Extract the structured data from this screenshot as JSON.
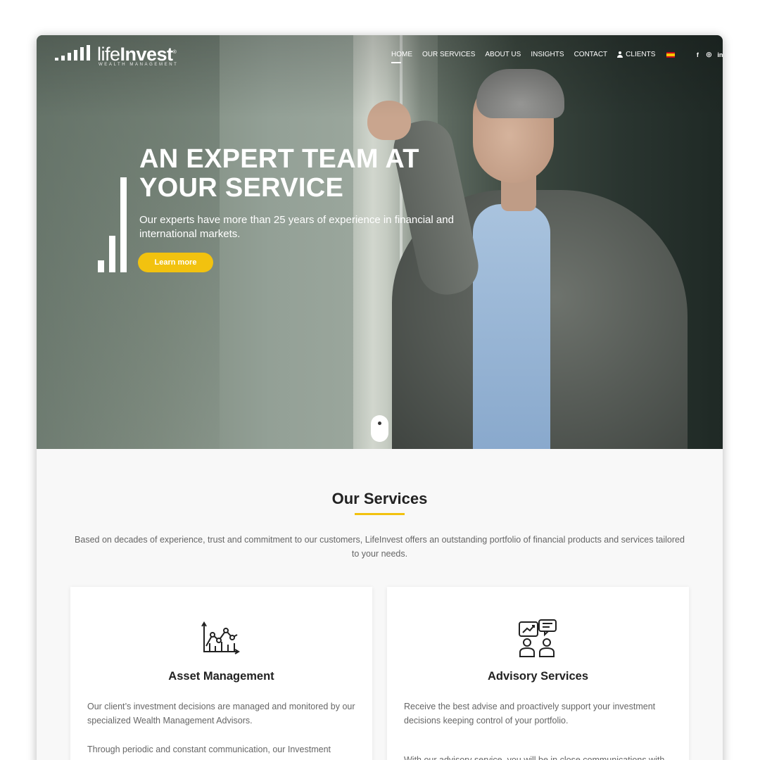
{
  "brand": {
    "name_light": "life",
    "name_bold": "Invest",
    "trademark": "®",
    "tagline": "WEALTH MANAGEMENT"
  },
  "nav": {
    "items": [
      "HOME",
      "OUR SERVICES",
      "ABOUT US",
      "INSIGHTS",
      "CONTACT"
    ],
    "active": "HOME",
    "clients_label": "CLIENTS",
    "language_flag": "spanish-flag-icon",
    "social": [
      "f",
      "◎",
      "in"
    ]
  },
  "hero": {
    "title": "AN EXPERT TEAM AT YOUR SERVICE",
    "subtitle": "Our experts have more than 25 years of experience in financial and international markets.",
    "button_label": "Learn more",
    "accent_color": "#f2c20f"
  },
  "services": {
    "title": "Our Services",
    "intro": "Based on decades of experience, trust and commitment to our customers, LifeInvest offers an outstanding portfolio of financial products and services tailored to your needs.",
    "cards": [
      {
        "icon": "line-chart-icon",
        "title": "Asset Management",
        "p1": "Our client’s investment decisions are managed and monitored by our specialized Wealth Management Advisors.",
        "p2": "Through periodic and constant communication, our Investment"
      },
      {
        "icon": "advisory-meeting-icon",
        "title": "Advisory Services",
        "p1": "Receive the best advise and proactively support your investment decisions keeping control of your portfolio.",
        "p2": "With our advisory service, you will be in close communications with"
      }
    ]
  }
}
